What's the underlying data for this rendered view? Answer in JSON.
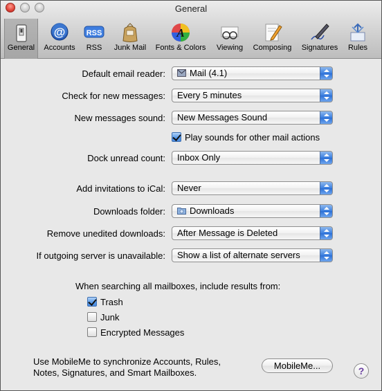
{
  "window": {
    "title": "General"
  },
  "toolbar": {
    "items": [
      {
        "label": "General",
        "icon": "general-switch-icon",
        "selected": true
      },
      {
        "label": "Accounts",
        "icon": "at-sign-icon"
      },
      {
        "label": "RSS",
        "icon": "rss-icon"
      },
      {
        "label": "Junk Mail",
        "icon": "junk-mail-bag-icon"
      },
      {
        "label": "Fonts & Colors",
        "icon": "fonts-colors-icon"
      },
      {
        "label": "Viewing",
        "icon": "viewing-glasses-icon"
      },
      {
        "label": "Composing",
        "icon": "composing-pencil-icon"
      },
      {
        "label": "Signatures",
        "icon": "signature-pen-icon"
      },
      {
        "label": "Rules",
        "icon": "rules-arrows-icon"
      }
    ]
  },
  "form": {
    "default_reader_label": "Default email reader:",
    "default_reader_value": "Mail (4.1)",
    "check_label": "Check for new messages:",
    "check_value": "Every 5 minutes",
    "sound_label": "New messages sound:",
    "sound_value": "New Messages Sound",
    "play_sounds_label": "Play sounds for other mail actions",
    "play_sounds_checked": true,
    "dock_label": "Dock unread count:",
    "dock_value": "Inbox Only",
    "ical_label": "Add invitations to iCal:",
    "ical_value": "Never",
    "downloads_label": "Downloads folder:",
    "downloads_value": "Downloads",
    "remove_label": "Remove unedited downloads:",
    "remove_value": "After Message is Deleted",
    "outgoing_label": "If outgoing server is unavailable:",
    "outgoing_value": "Show a list of alternate servers"
  },
  "search": {
    "heading": "When searching all mailboxes, include results from:",
    "options": [
      {
        "label": "Trash",
        "checked": true
      },
      {
        "label": "Junk",
        "checked": false
      },
      {
        "label": "Encrypted Messages",
        "checked": false
      }
    ]
  },
  "mobileme": {
    "text_line1": "Use MobileMe to synchronize Accounts, Rules,",
    "text_line2": "Notes, Signatures, and Smart Mailboxes.",
    "button_label": "MobileMe...",
    "help_label": "?"
  },
  "colors": {
    "accent": "#3b7fe0",
    "toolbar_bg": "#c8c8c8",
    "window_bg": "#e8e8e8"
  }
}
